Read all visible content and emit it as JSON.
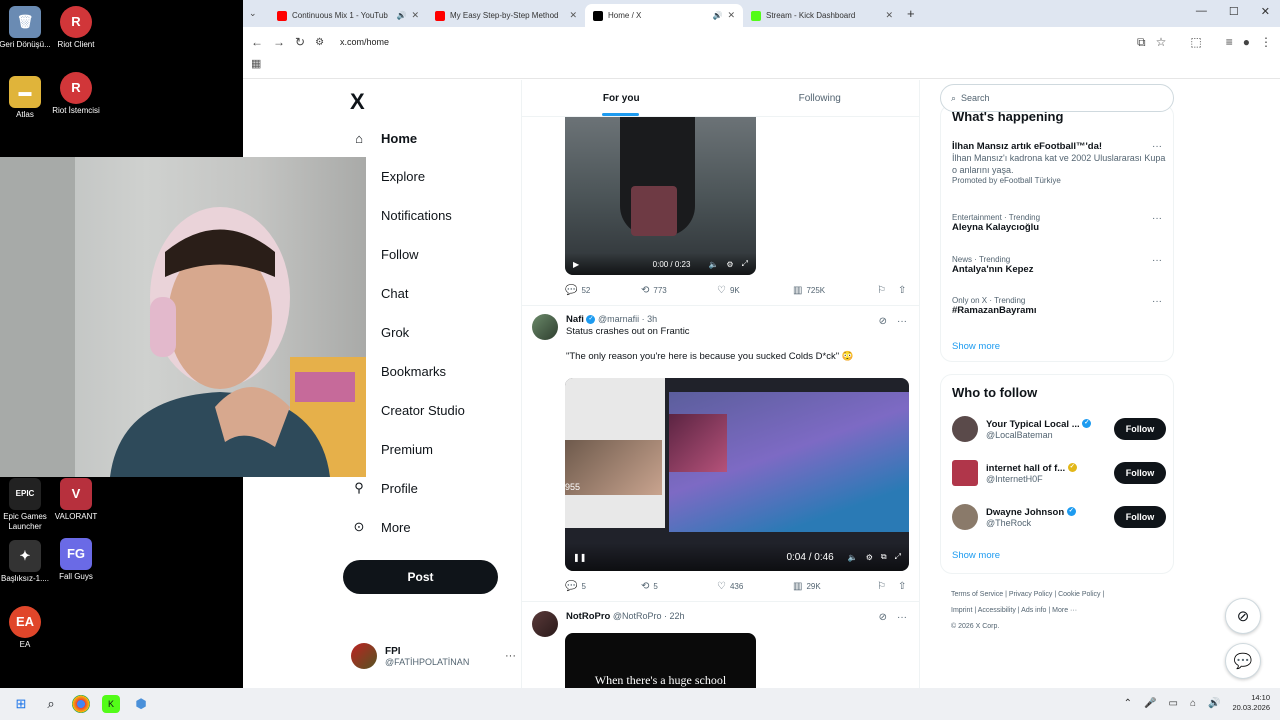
{
  "desktop": {
    "icons": [
      {
        "label": "Geri Dönüşü...",
        "glyph": "🗑",
        "color": "#6a8bb3"
      },
      {
        "label": "Riot Client",
        "glyph": "R",
        "color": "#d13639"
      },
      {
        "label": "Atlas",
        "glyph": "📁",
        "color": "#e0b43a"
      },
      {
        "label": "Riot İstemcisi",
        "glyph": "R",
        "color": "#d13639"
      },
      {
        "label": "Epic Games Launcher",
        "glyph": "EPIC",
        "color": "#222"
      },
      {
        "label": "VALORANT",
        "glyph": "V",
        "color": "#b7303d"
      },
      {
        "label": "Başlıksız-1....",
        "glyph": "✦",
        "color": "#333"
      },
      {
        "label": "Fall Guys",
        "glyph": "FG",
        "color": "#6a6ae6"
      },
      {
        "label": "EA",
        "glyph": "EA",
        "color": "#e0462a"
      }
    ]
  },
  "browser": {
    "tabs": [
      {
        "title": "Continuous Mix 1 - YouTub",
        "fav_color": "#ff0000"
      },
      {
        "title": "My Easy Step-by-Step Method",
        "fav_color": "#ff0000"
      },
      {
        "title": "Home / X",
        "fav_color": "#000000"
      },
      {
        "title": "Stream - Kick Dashboard",
        "fav_color": "#53fc18"
      }
    ],
    "url": "x.com/home"
  },
  "nav": {
    "logo": "X",
    "items": [
      {
        "label": "Home",
        "icon": "⌂"
      },
      {
        "label": "Explore",
        "icon": ""
      },
      {
        "label": "Notifications",
        "icon": ""
      },
      {
        "label": "Follow",
        "icon": ""
      },
      {
        "label": "Chat",
        "icon": ""
      },
      {
        "label": "Grok",
        "icon": ""
      },
      {
        "label": "Bookmarks",
        "icon": ""
      },
      {
        "label": "Creator Studio",
        "icon": ""
      },
      {
        "label": "Premium",
        "icon": ""
      },
      {
        "label": "Profile",
        "icon": "👤"
      },
      {
        "label": "More",
        "icon": "⋯"
      }
    ],
    "post_label": "Post",
    "account": {
      "name": "FPI",
      "handle": "@FATİHPOLATİNAN"
    }
  },
  "feed": {
    "tabs": [
      "For you",
      "Following"
    ],
    "tweet1": {
      "time": "0:00 / 0:23",
      "stats": {
        "replies": "52",
        "reposts": "773",
        "likes": "9K",
        "views": "725K"
      }
    },
    "tweet2": {
      "name": "Nafi",
      "handle": "@marnafii · 3h",
      "text": "Status crashes out on Frantic",
      "quote": "\"The only reason you're here is because you sucked Colds D*ck\" 😳",
      "time": "0:04 / 0:46",
      "overlay_num": "955",
      "stats": {
        "replies": "5",
        "reposts": "5",
        "likes": "436",
        "views": "29K"
      }
    },
    "tweet3": {
      "name": "NotRoPro",
      "handle": "@NotRoPro · 22h",
      "media_text": "When there's a huge school"
    }
  },
  "sidebar": {
    "search_placeholder": "Search",
    "happening": {
      "title": "What's happening",
      "promo": {
        "name": "İlhan Mansız artık eFootball™'da!",
        "desc": "İlhan Mansız'ı kadrona kat ve 2002 Uluslararası Kupa o anlarını yaşa.",
        "promoted": "Promoted by eFootball Türkiye"
      },
      "trends": [
        {
          "cat": "Entertainment · Trending",
          "name": "Aleyna Kalaycıoğlu"
        },
        {
          "cat": "News · Trending",
          "name": "Antalya'nın Kepez"
        },
        {
          "cat": "Only on X · Trending",
          "name": "#RamazanBayramı"
        }
      ],
      "show_more": "Show more"
    },
    "who": {
      "title": "Who to follow",
      "people": [
        {
          "name": "Your Typical Local ...",
          "handle": "@LocalBateman",
          "color": "#5a4a4a"
        },
        {
          "name": "internet hall of f...",
          "handle": "@InternetH0F",
          "color": "#b0364a"
        },
        {
          "name": "Dwayne Johnson",
          "handle": "@TheRock",
          "color": "#8a7a6a"
        }
      ],
      "follow_label": "Follow",
      "show_more": "Show more"
    },
    "footer": {
      "line1": "Terms of Service  |  Privacy Policy  |  Cookie Policy  |",
      "line2": "Imprint  |  Accessibility  |  Ads info  |  More ···",
      "line3": "© 2026 X Corp."
    }
  },
  "taskbar": {
    "time": "14:10",
    "date": "20.03.2026"
  }
}
